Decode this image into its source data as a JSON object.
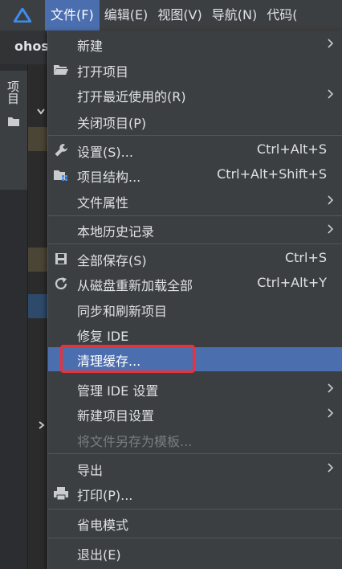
{
  "menubar": {
    "items": [
      {
        "label": "文件(F)"
      },
      {
        "label": "编辑(E)"
      },
      {
        "label": "视图(V)"
      },
      {
        "label": "导航(N)"
      },
      {
        "label": "代码("
      }
    ]
  },
  "project": {
    "name": "ohos"
  },
  "toolwindow": {
    "label": "项目"
  },
  "file_menu": {
    "new": "新建",
    "open_project": "打开项目",
    "open_recent": "打开最近使用的(R)",
    "close_project": "关闭项目(P)",
    "settings": "设置(S)...",
    "settings_shortcut": "Ctrl+Alt+S",
    "project_structure": "项目结构...",
    "project_structure_shortcut": "Ctrl+Alt+Shift+S",
    "file_properties": "文件属性",
    "local_history": "本地历史记录",
    "save_all": "全部保存(S)",
    "save_all_shortcut": "Ctrl+S",
    "reload_all": "从磁盘重新加载全部",
    "reload_all_shortcut": "Ctrl+Alt+Y",
    "sync_refresh": "同步和刷新项目",
    "repair_ide": "修复 IDE",
    "invalidate_caches": "清理缓存...",
    "manage_ide_settings": "管理 IDE 设置",
    "new_project_settings": "新建项目设置",
    "save_as_template": "将文件另存为模板...",
    "export": "导出",
    "print": "打印(P)...",
    "power_save": "省电模式",
    "exit": "退出(E)"
  },
  "colors": {
    "accent": "#4b6eaf",
    "highlight_border": "#e8323c"
  }
}
